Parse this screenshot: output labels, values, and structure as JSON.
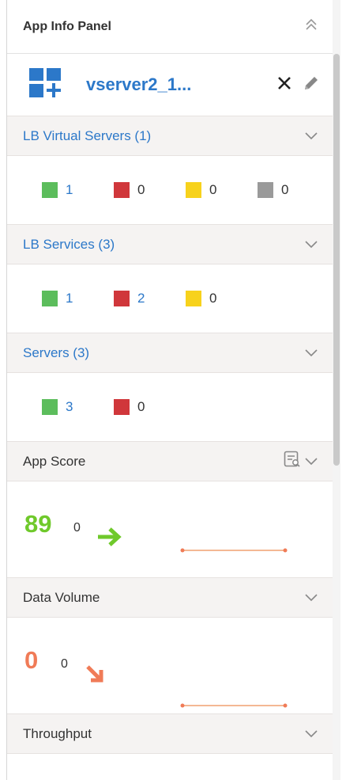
{
  "panel": {
    "title": "App Info Panel",
    "collapse_icon": "double-chevron-up-icon"
  },
  "app": {
    "name": "vserver2_1...",
    "icon": "app-grid-plus-icon",
    "close_icon": "close-icon",
    "edit_icon": "pencil-icon"
  },
  "colors": {
    "green": "#5cbd5c",
    "red": "#d0373b",
    "yellow": "#f7d21c",
    "gray": "#9a9a9a",
    "link": "#2c78c9",
    "score_green": "#6fc92b",
    "volume_orange": "#f07b57"
  },
  "sections": {
    "lb_virtual_servers": {
      "label": "LB Virtual Servers (1)",
      "counts": [
        "1",
        "0",
        "0",
        "0"
      ]
    },
    "lb_services": {
      "label": "LB Services (3)",
      "counts": [
        "1",
        "2",
        "0"
      ]
    },
    "servers": {
      "label": "Servers (3)",
      "counts": [
        "3",
        "0"
      ]
    },
    "app_score": {
      "label": "App Score",
      "value": "89",
      "change": "0",
      "trend": "up-right-arrow-icon"
    },
    "data_volume": {
      "label": "Data Volume",
      "value": "0",
      "change": "0",
      "trend": "down-right-arrow-icon"
    },
    "throughput": {
      "label": "Throughput"
    }
  }
}
